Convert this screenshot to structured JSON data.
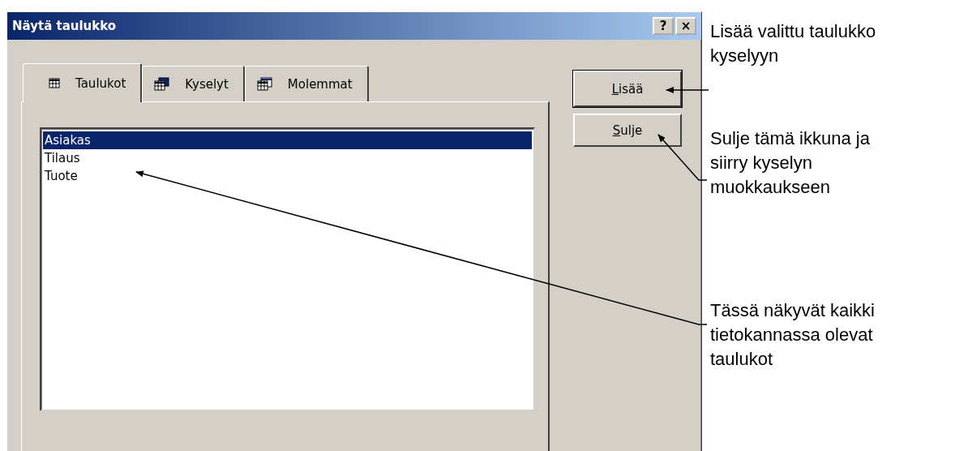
{
  "window": {
    "title": "Näytä taulukko",
    "help_button": "?",
    "close_button": "×"
  },
  "tabs": [
    {
      "label": "Taulukot",
      "kind": "table",
      "selected": true
    },
    {
      "label": "Kyselyt",
      "kind": "query",
      "selected": false
    },
    {
      "label": "Molemmat",
      "kind": "both",
      "selected": false
    }
  ],
  "list": [
    {
      "label": "Asiakas",
      "selected": true
    },
    {
      "label": "Tilaus",
      "selected": false
    },
    {
      "label": "Tuote",
      "selected": false
    }
  ],
  "buttons": [
    {
      "label": "Lisää",
      "default": true
    },
    {
      "label": "Sulje",
      "default": false
    }
  ],
  "annotations": [
    {
      "lines": [
        "Lisää valittu taulukko",
        "kyselyyn"
      ]
    },
    {
      "lines": [
        "Sulje tämä ikkuna ja",
        "siirry kyselyn",
        "muokkaukseen"
      ]
    },
    {
      "lines": [
        "Tässä näkyvät kaikki",
        "tietokannassa olevat",
        "taulukot"
      ]
    }
  ]
}
